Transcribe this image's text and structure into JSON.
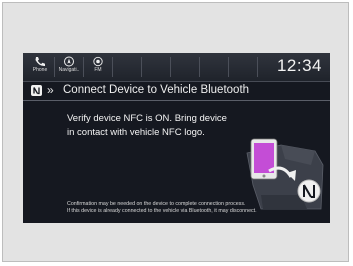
{
  "statusbar": {
    "buttons": [
      {
        "label": "Phone",
        "icon": "phone-icon"
      },
      {
        "label": "Navigati..",
        "icon": "navigation-icon"
      },
      {
        "label": "FM",
        "icon": "radio-icon"
      }
    ],
    "clock": "12:34"
  },
  "titlebar": {
    "icon": "nfc-icon",
    "title": "Connect Device to Vehicle Bluetooth"
  },
  "main": {
    "instruction_line1": "Verify device NFC is ON. Bring device",
    "instruction_line2": "in contact with vehicle NFC logo.",
    "illustration": "phone-to-nfc-illustration",
    "footnote_line1": "Confirmation may be needed on the device to complete connection process.",
    "footnote_line2": "If this device is already connected to the vehicle via Bluetooth, it may disconnect."
  },
  "colors": {
    "screen_bg": "#151820",
    "phone_screen": "#c44dd6",
    "text": "#f4f4f4"
  }
}
